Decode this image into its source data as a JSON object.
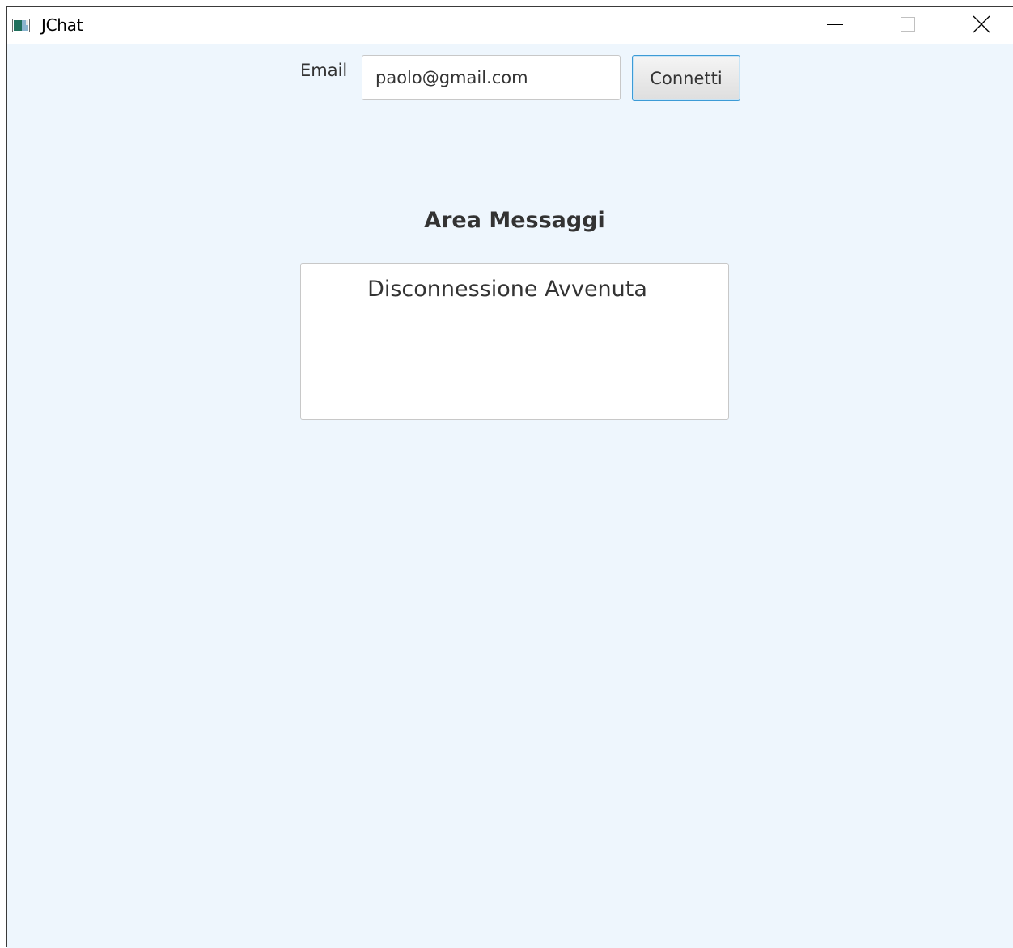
{
  "window": {
    "title": "JChat"
  },
  "titlebar": {
    "icons": [
      "app-icon",
      "minimize-icon",
      "maximize-icon",
      "close-icon"
    ]
  },
  "connection": {
    "email_label": "Email",
    "email_value": "paolo@gmail.com",
    "connect_label": "Connetti"
  },
  "messages": {
    "title": "Area Messaggi",
    "text": "Disconnessione Avvenuta"
  },
  "colors": {
    "background": "#eef6fd",
    "button_border": "#3c9bd6",
    "text": "#333333"
  }
}
